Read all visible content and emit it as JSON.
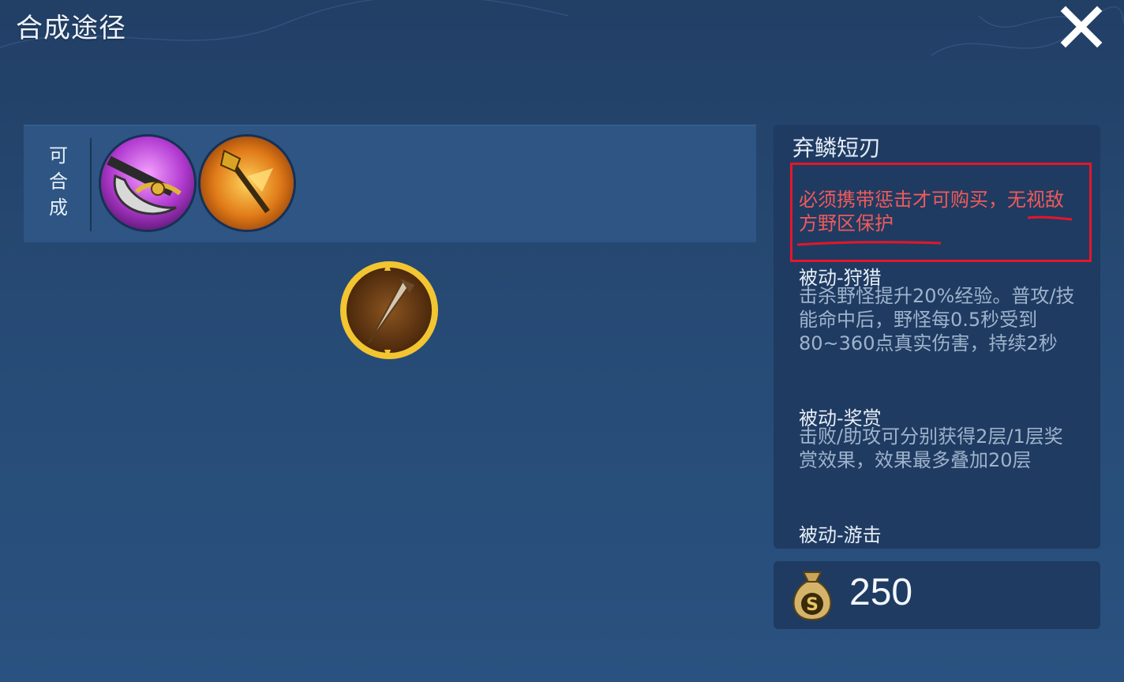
{
  "header": {
    "title": "合成途径"
  },
  "recipe": {
    "label": "可合成",
    "items": [
      {
        "icon": "axe-item-icon"
      },
      {
        "icon": "flame-spear-item-icon"
      }
    ]
  },
  "result": {
    "icon": "short-blade-icon"
  },
  "item": {
    "name": "弃鳞短刃",
    "requirement": "必须携带惩击才可购买，无视敌方野区保护",
    "passives": [
      {
        "title": "被动-狩猎",
        "desc": "击杀野怪提升20%经验。普攻/技能命中后，野怪每0.5秒受到80~360点真实伤害，持续2秒"
      },
      {
        "title": "被动-奖赏",
        "desc": "击败/助攻可分别获得2层/1层奖赏效果，效果最多叠加20层"
      },
      {
        "title": "被动-游击",
        "desc": ""
      }
    ]
  },
  "price": {
    "value": "250",
    "icon": "gold-bag-icon"
  },
  "colors": {
    "background": "#264a74",
    "panel": "#1f3b62",
    "highlight": "#e5162a",
    "requirement_text": "#f05a5a"
  }
}
